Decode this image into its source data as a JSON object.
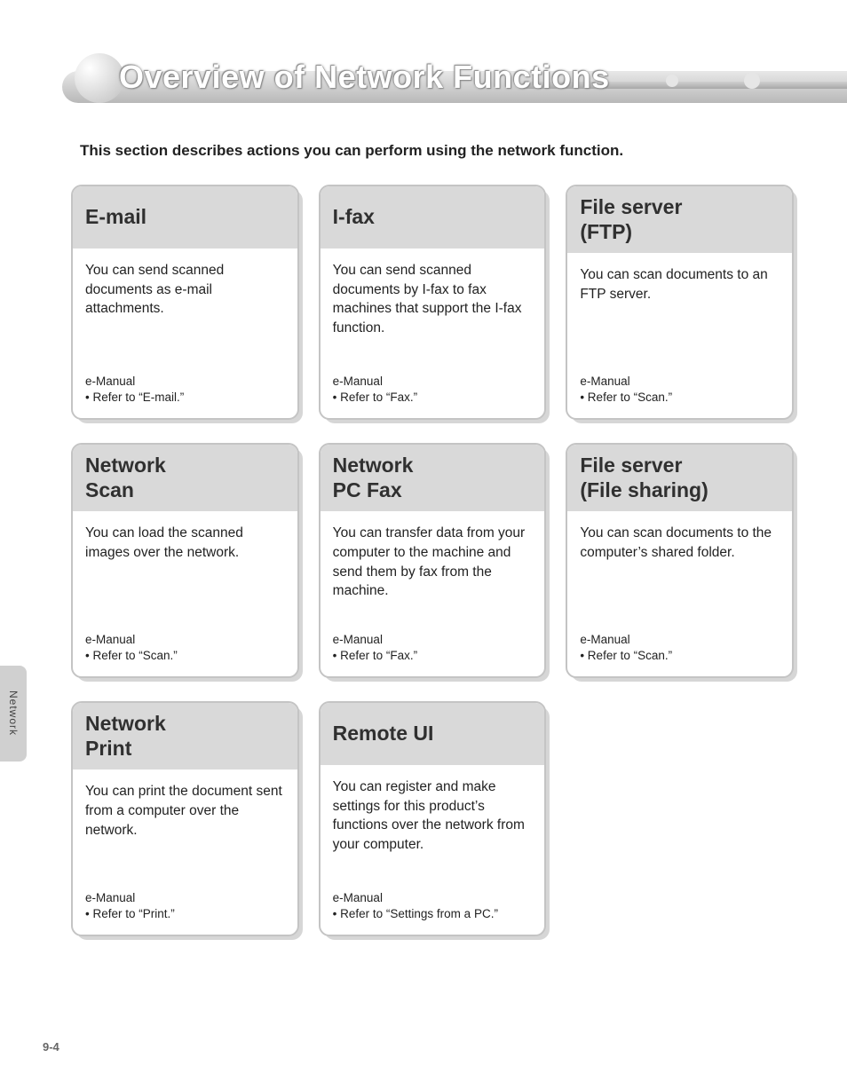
{
  "title": "Overview of Network Functions",
  "intro": "This section describes actions you can perform using the network function.",
  "side_tab": "Network",
  "page_number": "9-4",
  "cards": [
    {
      "title": "E-mail",
      "description": "You can send scanned documents as e-mail attachments.",
      "ref_label": "e-Manual",
      "ref_text": "• Refer to “E-mail.”"
    },
    {
      "title": "I-fax",
      "description": "You can send scanned documents by I-fax to fax machines that support the I-fax function.",
      "ref_label": "e-Manual",
      "ref_text": "• Refer to “Fax.”"
    },
    {
      "title": "File server\n(FTP)",
      "description": "You can scan documents to an FTP server.",
      "ref_label": "e-Manual",
      "ref_text": "• Refer to “Scan.”"
    },
    {
      "title": "Network\nScan",
      "description": "You can load the scanned images over the network.",
      "ref_label": "e-Manual",
      "ref_text": "• Refer to “Scan.”"
    },
    {
      "title": "Network\nPC Fax",
      "description": "You can transfer data from your computer to the machine and send them by fax from the machine.",
      "ref_label": "e-Manual",
      "ref_text": "• Refer to “Fax.”"
    },
    {
      "title": "File server\n(File sharing)",
      "description": "You can scan documents to the computer’s shared folder.",
      "ref_label": "e-Manual",
      "ref_text": "• Refer to “Scan.”"
    },
    {
      "title": "Network\nPrint",
      "description": "You can print the document sent from a computer over the network.",
      "ref_label": "e-Manual",
      "ref_text": "• Refer to “Print.”"
    },
    {
      "title": "Remote UI",
      "description": "You can register and make settings for this product’s functions over the network from your computer.",
      "ref_label": "e-Manual",
      "ref_text": "• Refer to “Settings from a PC.”"
    }
  ]
}
